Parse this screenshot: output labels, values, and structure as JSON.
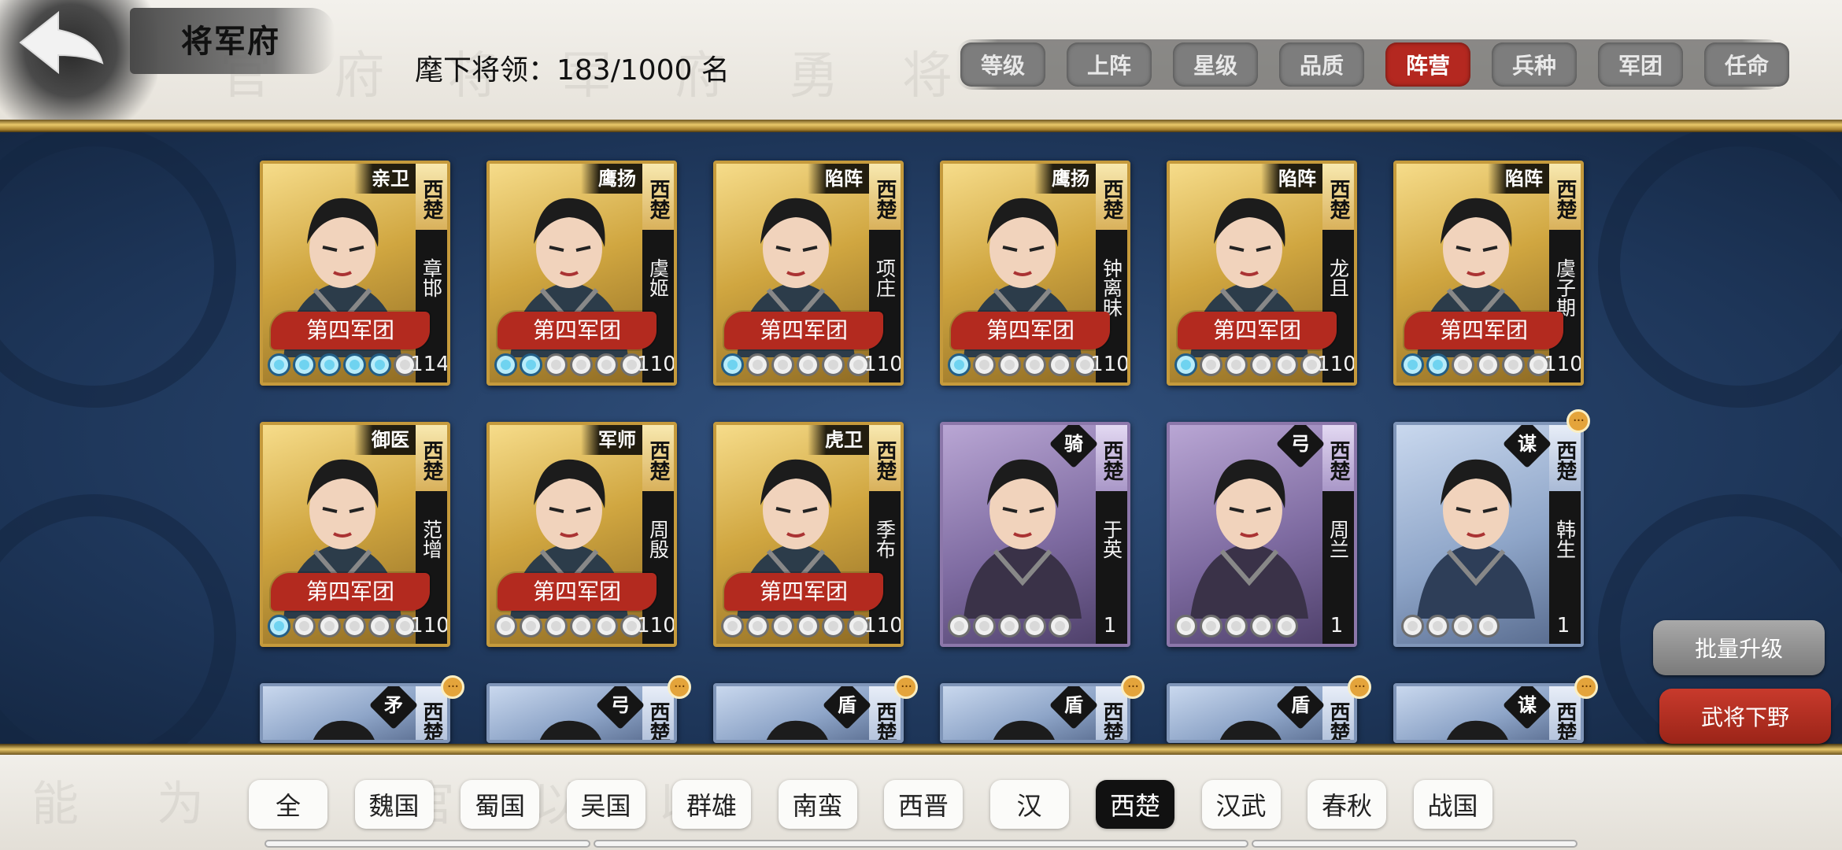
{
  "header": {
    "title": "将军府",
    "count_text": "麾下将领：183/1000 名"
  },
  "sort_tabs": [
    {
      "label": "等级",
      "active": false
    },
    {
      "label": "上阵",
      "active": false
    },
    {
      "label": "星级",
      "active": false
    },
    {
      "label": "品质",
      "active": false
    },
    {
      "label": "阵营",
      "active": true
    },
    {
      "label": "兵种",
      "active": false
    },
    {
      "label": "军团",
      "active": false
    },
    {
      "label": "任命",
      "active": false
    }
  ],
  "generals": [
    {
      "name": "章邯",
      "faction": "西楚",
      "role": "亲卫",
      "legion": "第四军团",
      "stars_lit": 5,
      "stars_total": 6,
      "level": "114",
      "tier": "gold"
    },
    {
      "name": "虞姬",
      "faction": "西楚",
      "role": "鹰扬",
      "legion": "第四军团",
      "stars_lit": 2,
      "stars_total": 6,
      "level": "110",
      "tier": "gold"
    },
    {
      "name": "项庄",
      "faction": "西楚",
      "role": "陷阵",
      "legion": "第四军团",
      "stars_lit": 1,
      "stars_total": 6,
      "level": "110",
      "tier": "gold"
    },
    {
      "name": "钟离昧",
      "faction": "西楚",
      "role": "鹰扬",
      "legion": "第四军团",
      "stars_lit": 1,
      "stars_total": 6,
      "level": "110",
      "tier": "gold"
    },
    {
      "name": "龙且",
      "faction": "西楚",
      "role": "陷阵",
      "legion": "第四军团",
      "stars_lit": 1,
      "stars_total": 6,
      "level": "110",
      "tier": "gold"
    },
    {
      "name": "虞子期",
      "faction": "西楚",
      "role": "陷阵",
      "legion": "第四军团",
      "stars_lit": 2,
      "stars_total": 6,
      "level": "110",
      "tier": "gold"
    },
    {
      "name": "范增",
      "faction": "西楚",
      "role": "御医",
      "legion": "第四军团",
      "stars_lit": 1,
      "stars_total": 6,
      "level": "110",
      "tier": "gold"
    },
    {
      "name": "周殷",
      "faction": "西楚",
      "role": "军师",
      "legion": "第四军团",
      "stars_lit": 0,
      "stars_total": 6,
      "level": "110",
      "tier": "gold"
    },
    {
      "name": "季布",
      "faction": "西楚",
      "role": "虎卫",
      "legion": "第四军团",
      "stars_lit": 0,
      "stars_total": 6,
      "level": "110",
      "tier": "gold"
    },
    {
      "name": "于英",
      "faction": "西楚",
      "role": "骑",
      "legion": "",
      "stars_lit": 0,
      "stars_total": 5,
      "level": "1",
      "tier": "purple"
    },
    {
      "name": "周兰",
      "faction": "西楚",
      "role": "弓",
      "legion": "",
      "stars_lit": 0,
      "stars_total": 5,
      "level": "1",
      "tier": "purple"
    },
    {
      "name": "韩生",
      "faction": "西楚",
      "role": "谋",
      "legion": "",
      "stars_lit": 0,
      "stars_total": 4,
      "level": "1",
      "tier": "blue"
    }
  ],
  "partial_row": [
    {
      "faction": "西楚",
      "role": "矛",
      "tier": "blue"
    },
    {
      "faction": "西楚",
      "role": "弓",
      "tier": "blue"
    },
    {
      "faction": "西楚",
      "role": "盾",
      "tier": "blue"
    },
    {
      "faction": "西楚",
      "role": "盾",
      "tier": "blue"
    },
    {
      "faction": "西楚",
      "role": "盾",
      "tier": "blue"
    },
    {
      "faction": "西楚",
      "role": "谋",
      "tier": "blue"
    }
  ],
  "actions": {
    "batch_upgrade": "批量升级",
    "dismiss": "武将下野"
  },
  "faction_tabs": [
    {
      "label": "全",
      "active": false
    },
    {
      "label": "魏国",
      "active": false
    },
    {
      "label": "蜀国",
      "active": false
    },
    {
      "label": "吴国",
      "active": false
    },
    {
      "label": "群雄",
      "active": false
    },
    {
      "label": "南蛮",
      "active": false
    },
    {
      "label": "西晋",
      "active": false
    },
    {
      "label": "汉",
      "active": false
    },
    {
      "label": "西楚",
      "active": true
    },
    {
      "label": "汉武",
      "active": false
    },
    {
      "label": "春秋",
      "active": false
    },
    {
      "label": "战国",
      "active": false
    }
  ],
  "colors": {
    "active_red": "#b42820",
    "gold_border": "#c59a3c",
    "main_blue": "#1d3558",
    "star_lit": "#6fd3f0"
  }
}
